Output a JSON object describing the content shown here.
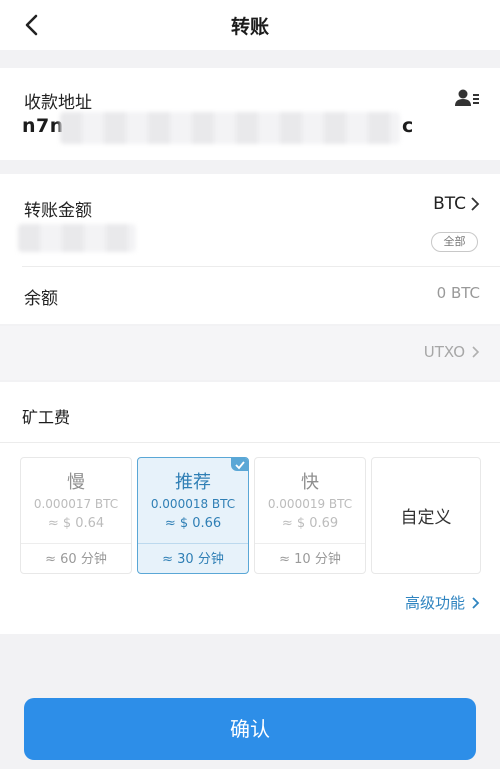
{
  "header": {
    "title": "转账"
  },
  "recipient": {
    "label": "收款地址",
    "address_start": "n7na",
    "address_end": "c"
  },
  "amount": {
    "label": "转账金额",
    "currency": "BTC",
    "all_label": "全部"
  },
  "balance": {
    "label": "余额",
    "value": "0 BTC"
  },
  "utxo": {
    "label": "UTXO"
  },
  "fee": {
    "label": "矿工费",
    "options": [
      {
        "name": "慢",
        "btc": "0.000017 BTC",
        "usd": "≈ $ 0.64",
        "time": "≈ 60 分钟",
        "selected": false
      },
      {
        "name": "推荐",
        "btc": "0.000018 BTC",
        "usd": "≈ $ 0.66",
        "time": "≈ 30 分钟",
        "selected": true
      },
      {
        "name": "快",
        "btc": "0.000019 BTC",
        "usd": "≈ $ 0.69",
        "time": "≈ 10 分钟",
        "selected": false
      }
    ],
    "custom_label": "自定义"
  },
  "advanced": {
    "label": "高级功能"
  },
  "confirm": {
    "label": "确认"
  },
  "colors": {
    "accent": "#2d8ee8",
    "selected_border": "#5aa7d6",
    "link": "#2f84c0"
  }
}
